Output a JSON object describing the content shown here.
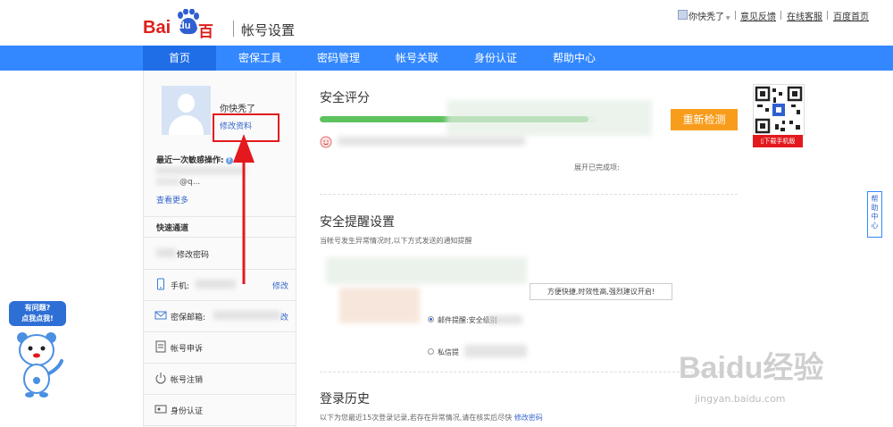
{
  "header": {
    "logo_text_bai": "Bai",
    "logo_text_du": "du",
    "logo_text_cn": "百度",
    "page_title": "帐号设置",
    "user_label": "你快秃了",
    "links": [
      "意见反馈",
      "在线客服",
      "百度首页"
    ]
  },
  "nav": {
    "items": [
      "首页",
      "密保工具",
      "密码管理",
      "帐号关联",
      "身份认证",
      "帮助中心"
    ],
    "active_index": 0
  },
  "sidebar": {
    "username": "你快秃了",
    "edit_profile": "修改资料",
    "recent_label": "最近一次敏感操作:",
    "recent_icon": "?",
    "email_fragment": "@q...",
    "more_link": "查看更多",
    "quick_title": "快速通道",
    "rows": [
      {
        "label": "修改密码",
        "action": "",
        "icon": "lock-icon"
      },
      {
        "label": "手机:",
        "action": "修改",
        "icon": "phone-icon"
      },
      {
        "label": "密保邮箱:",
        "action": "改",
        "icon": "mail-icon"
      },
      {
        "label": "帐号申诉",
        "action": "",
        "icon": "appeal-icon"
      },
      {
        "label": "帐号注销",
        "action": "",
        "icon": "power-icon"
      },
      {
        "label": "身份认证",
        "action": "",
        "icon": "id-card-icon"
      }
    ]
  },
  "security_score": {
    "title": "安全评分",
    "progress": 0.97,
    "recheck_button": "重新检测",
    "expand_text": "展开已完成项:"
  },
  "alerts": {
    "title": "安全提醒设置",
    "description": "当帐号发生异常情况时,以下方式发送的通知提醒",
    "tooltip": "方便快捷,时效性高,强烈建议开启!",
    "options": [
      "邮件提醒:安全级别",
      "私信提"
    ]
  },
  "login_history": {
    "title": "登录历史",
    "description": "以下为您最近15次登录记录,若存在异常情况,请在核实后尽快",
    "link": "修改密码"
  },
  "qr": {
    "download_label": "下载手机版"
  },
  "help_tab": "帮助中心",
  "mascot": {
    "line1": "有问题?",
    "line2": "点我点我!"
  },
  "watermark": {
    "main": "Baidu经验",
    "url": "jingyan.baidu.com"
  },
  "colors": {
    "nav": "#3388ff",
    "accent_red": "#e3191d",
    "recheck": "#f89c1c",
    "progress": "#5ec25e",
    "link": "#3366cc"
  }
}
